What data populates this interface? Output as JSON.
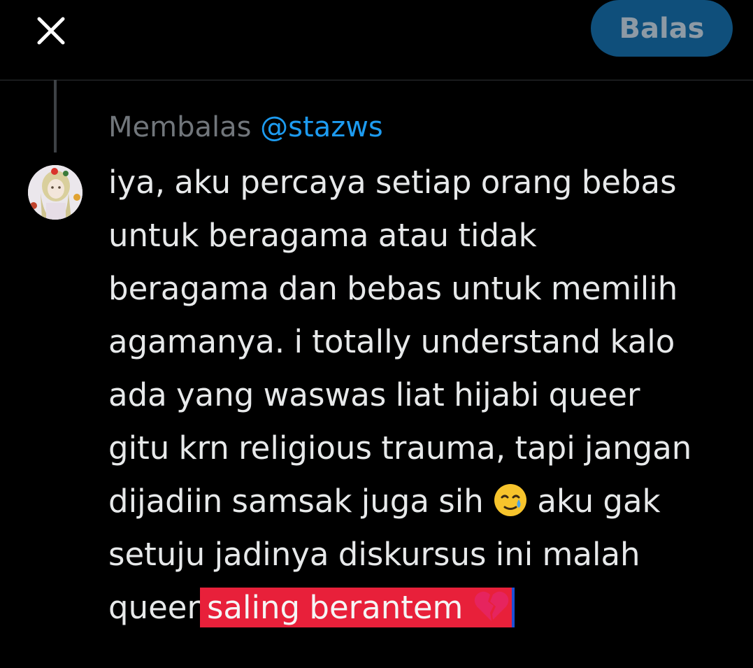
{
  "header": {
    "close_icon": "close-icon",
    "reply_button_label": "Balas"
  },
  "reply_context": {
    "prefix": "Membalas",
    "handle": "@stazws"
  },
  "author": {
    "avatar_icon": "avatar"
  },
  "tweet": {
    "lines": [
      "iya, aku percaya setiap orang bebas",
      "untuk beragama atau tidak",
      "beragama dan bebas untuk memilih",
      "agamanya. i totally understand kalo",
      "ada yang waswas liat hijabi queer",
      "gitu krn religious trauma, tapi jangan"
    ],
    "line7_before_emoji": "dijadiin samsak juga sih",
    "line7_emoji": "smiling-face-with-tear",
    "line7_after_emoji": "aku gak",
    "line8": "setuju jadinya diskursus ini malah",
    "line9_before_selection": "queer",
    "line9_selection": "saling berantem",
    "line9_emoji": "broken-heart",
    "selection_color": "#e8203a"
  },
  "colors": {
    "background": "#000000",
    "text": "#e7e9ea",
    "muted": "#71767b",
    "link": "#1d9bf0",
    "reply_button_bg": "#0f4f7b",
    "reply_button_text": "#8d9aa5"
  }
}
